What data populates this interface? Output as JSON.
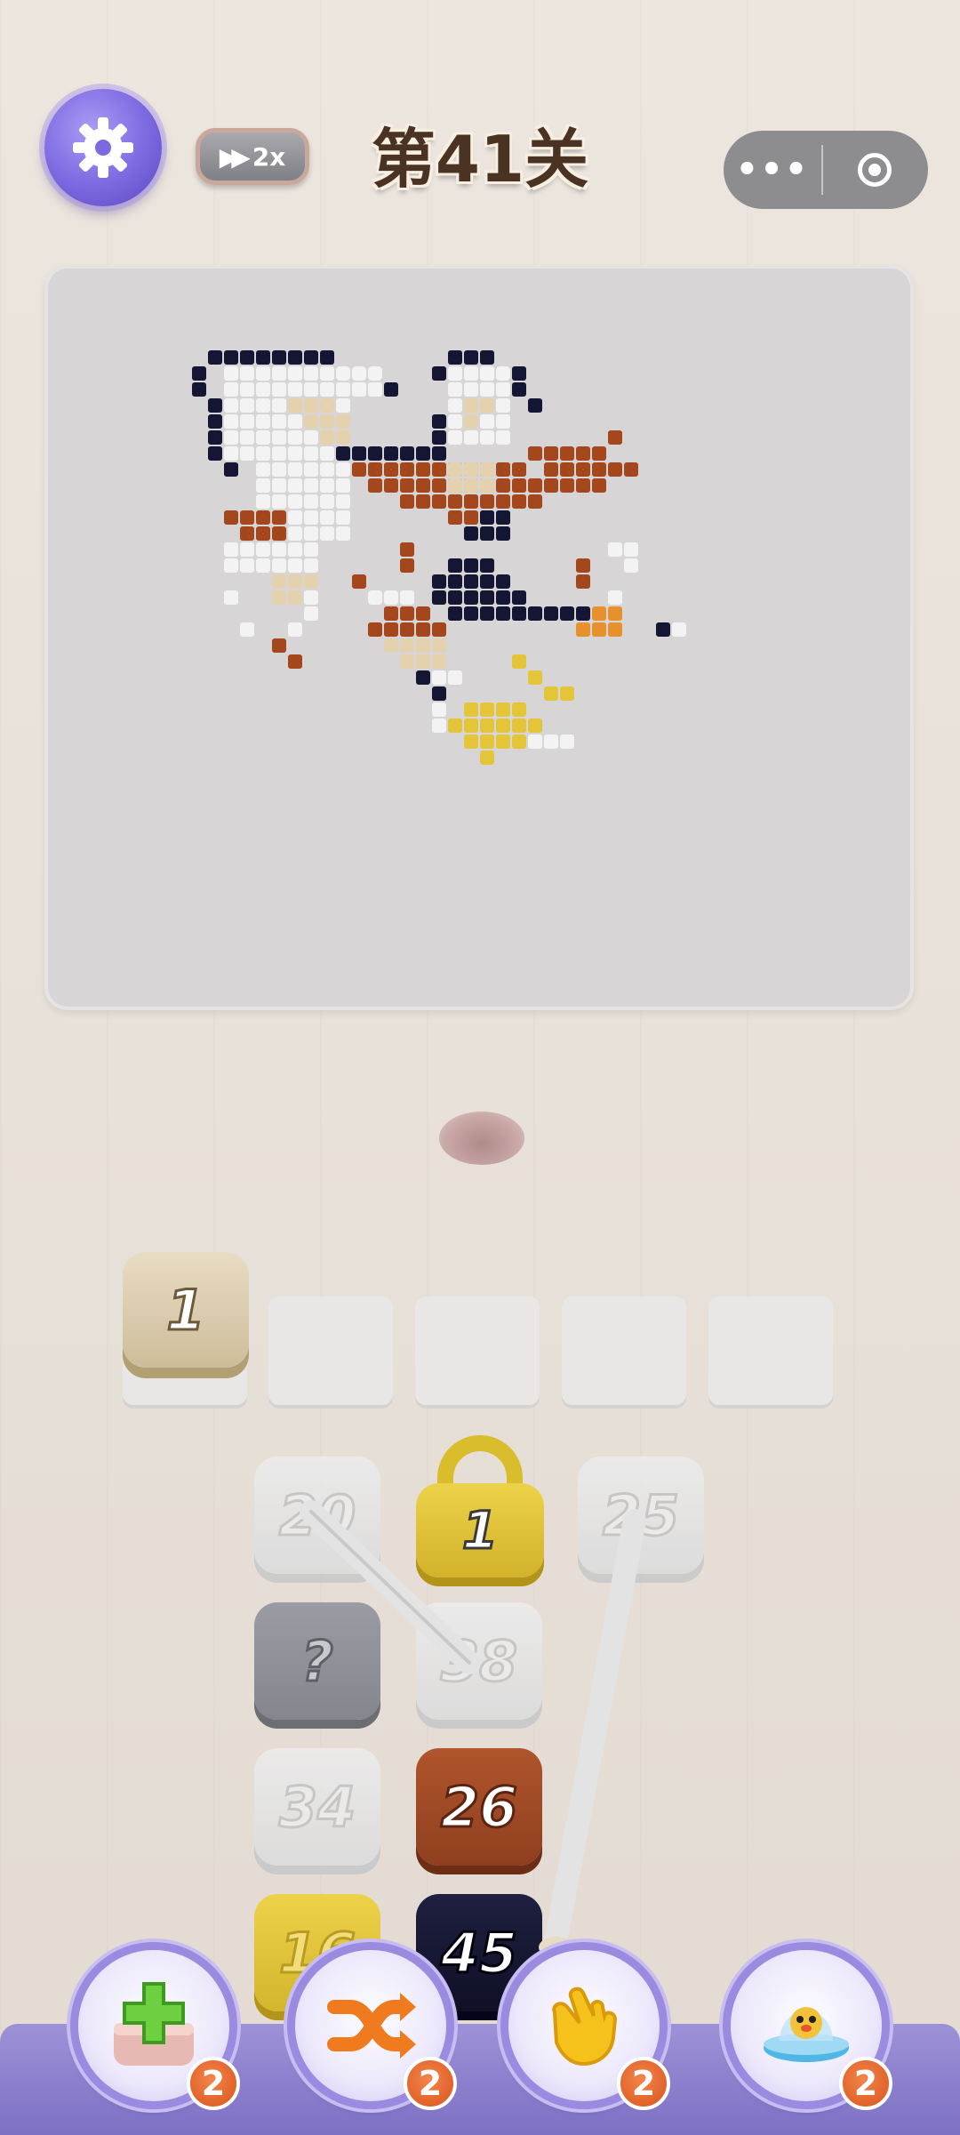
{
  "header": {
    "speed_label": "2x",
    "level_title": "第41关",
    "menu_more": "•••"
  },
  "tray": {
    "slots": [
      {
        "value": "1",
        "color": "beige"
      },
      {
        "value": ""
      },
      {
        "value": ""
      },
      {
        "value": ""
      },
      {
        "value": ""
      }
    ]
  },
  "tiles": {
    "t20": "20",
    "locked": "1",
    "t25": "25",
    "hidden": "?",
    "t38": "38",
    "t34": "34",
    "t26": "26",
    "t16": "16",
    "t45": "45"
  },
  "powerups": {
    "add_count": "2",
    "shuffle_count": "2",
    "undo_count": "2",
    "helper_count": "2"
  },
  "colors": {
    "navy": "#141633",
    "white": "#f3f3f4",
    "brown": "#a4471d",
    "cream": "#e3d2ad",
    "yellow": "#e4c53a",
    "orange": "#e6912d"
  }
}
